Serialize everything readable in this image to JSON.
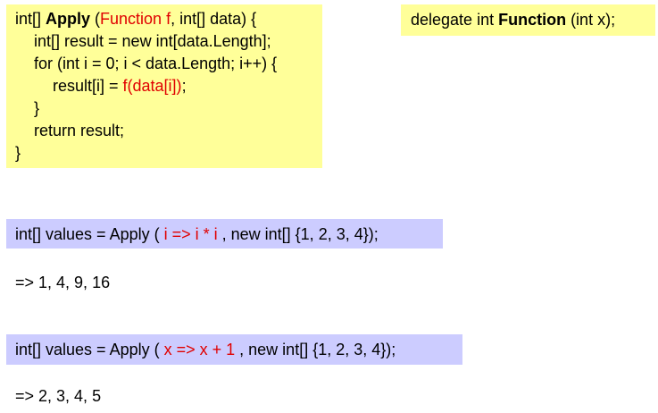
{
  "apply_code": {
    "line1": {
      "part1": "int[] ",
      "method_name": "Apply",
      "part2": " (",
      "func_param": "Function f",
      "part3": ", int[] data) {"
    },
    "line2": "int[] result = new int[data.Length];",
    "line3": "for (int i = 0; i < data.Length; i++) {",
    "line4": {
      "part1": "result[i] = ",
      "call": "f(data[i])",
      "part2": ";"
    },
    "line5": "}",
    "line6": "return result;",
    "line7": "}"
  },
  "delegate_decl": {
    "part1": "delegate int ",
    "type_name": "Function",
    "part2": " (int x);"
  },
  "example1": {
    "part1": "int[] values = Apply ( ",
    "lambda": "i => i * i",
    "part2": " , new int[] {1, 2, 3, 4});",
    "result": "=> 1, 4, 9, 16"
  },
  "example2": {
    "part1": "int[] values = Apply ( ",
    "lambda": "x => x + 1",
    "part2": " , new int[] {1, 2, 3, 4});",
    "result": "=> 2, 3, 4, 5"
  },
  "colors": {
    "code_box": "#ffff99",
    "call_box": "#ccccff",
    "highlight": "#e00000"
  }
}
